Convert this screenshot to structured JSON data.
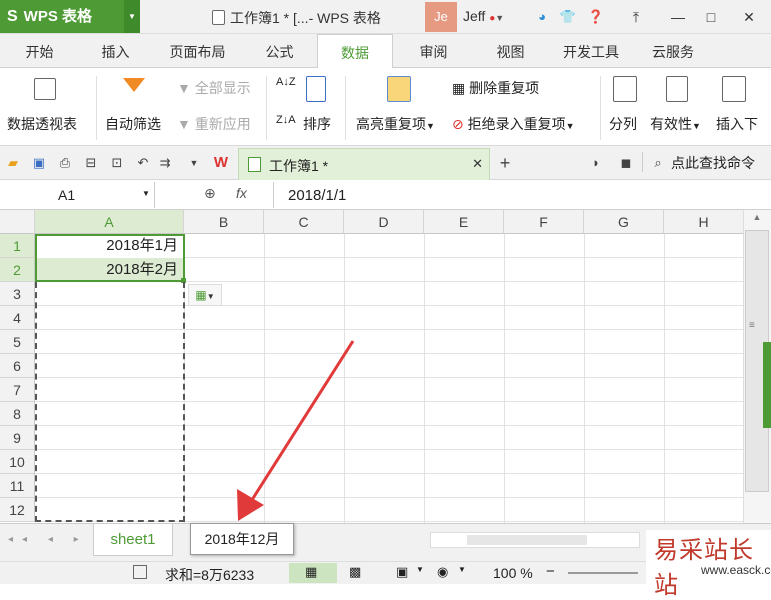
{
  "app": {
    "name": "WPS 表格",
    "logo": "S",
    "doc_title": "工作簿1 * [...- WPS 表格",
    "avatar": "Je",
    "user": "Jeff"
  },
  "tabs": [
    "开始",
    "插入",
    "页面布局",
    "公式",
    "数据",
    "审阅",
    "视图",
    "开发工具",
    "云服务"
  ],
  "ribbon": {
    "pivot": "数据透视表",
    "autofilter": "自动筛选",
    "show_all": "全部显示",
    "reapply": "重新应用",
    "sort": "排序",
    "highlight_dup": "高亮重复项",
    "remove_dup": "删除重复项",
    "reject_dup": "拒绝录入重复项",
    "split": "分列",
    "validity": "有效性",
    "insert": "插入下"
  },
  "doc_tab": "工作簿1 *",
  "search_cmd": "点此查找命令",
  "namebox": "A1",
  "fx": "fx",
  "formula_value": "2018/1/1",
  "columns": [
    "A",
    "B",
    "C",
    "D",
    "E",
    "F",
    "G",
    "H"
  ],
  "rows": [
    "1",
    "2",
    "3",
    "4",
    "5",
    "6",
    "7",
    "8",
    "9",
    "10",
    "11",
    "12"
  ],
  "cells": {
    "A1": "2018年1月",
    "A2": "2018年2月"
  },
  "tooltip": "2018年12月",
  "sheet": "sheet1",
  "status": {
    "sum": "求和=8万6233",
    "zoom": "100 %"
  },
  "watermark": {
    "big": "易采站长站",
    "small": "www.easck.com"
  },
  "colors": {
    "accent": "#4e9b36",
    "arrow": "#e03a3a"
  }
}
